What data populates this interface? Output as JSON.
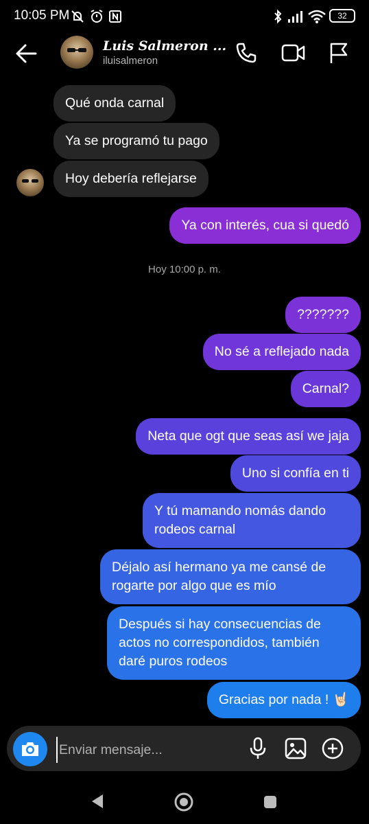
{
  "status_bar": {
    "time": "10:05 PM",
    "battery": "32"
  },
  "header": {
    "name": "Luis Salmeron ...",
    "username": "iluisalmeron"
  },
  "messages_incoming": [
    {
      "text": "Qué onda carnal"
    },
    {
      "text": "Ya se programó tu pago"
    },
    {
      "text": "Hoy debería reflejarse"
    }
  ],
  "messages_outgoing": [
    {
      "text": "Ya con interés, cua si quedó",
      "color": "#8a2fd6"
    },
    {
      "text": "???????",
      "color": "#7b33d8"
    },
    {
      "text": "No sé a reflejado nada",
      "color": "#7136d9"
    },
    {
      "text": "Carnal?",
      "color": "#6a38da"
    },
    {
      "text": "Neta que ogt que seas así we jaja",
      "color": "#5a41dc"
    },
    {
      "text": "Uno si confía en ti",
      "color": "#4f49de"
    },
    {
      "text": "Y tú mamando nomás dando rodeos carnal",
      "color": "#4357e0"
    },
    {
      "text": "Déjalo así hermano ya me cansé de rogarte por algo que es mío",
      "color": "#3665e4"
    },
    {
      "text": "Después si hay consecuencias de actos no correspondidos, también daré puros rodeos",
      "color": "#2a72e8"
    },
    {
      "text": "Gracias por nada ! 🤘🏻",
      "color": "#1e7eec"
    }
  ],
  "timestamp": "Hoy 10:00 p. m.",
  "composer": {
    "placeholder": "Enviar mensaje..."
  },
  "accent_colors": {
    "camera": "#1e88f0",
    "composer_bg": "#262626",
    "incoming_bg": "#262626"
  }
}
